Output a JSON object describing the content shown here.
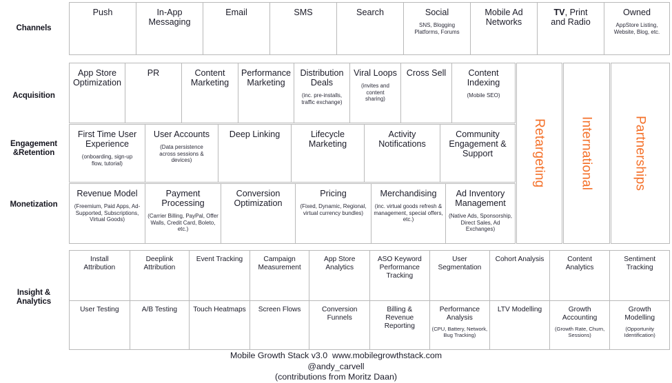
{
  "meta": {
    "accent_color": "#f4712a",
    "border_color": "#b9b9b9",
    "text_color": "#1b1b28"
  },
  "row_labels": {
    "channels": "Channels",
    "acquisition": "Acquisition",
    "engagement": "Engagement\n&Retention",
    "monetization": "Monetization",
    "insight": "Insight &\nAnalytics"
  },
  "channels": {
    "label": "Channels",
    "cells": [
      {
        "title": "Push",
        "sub": ""
      },
      {
        "title": "In-App\nMessaging",
        "sub": ""
      },
      {
        "title": "Email",
        "sub": ""
      },
      {
        "title": "SMS",
        "sub": ""
      },
      {
        "title": "Search",
        "sub": ""
      },
      {
        "title": "Social",
        "sub": "SNS, Blogging\nPlatforms, Forums"
      },
      {
        "title": "Mobile Ad\nNetworks",
        "sub": ""
      },
      {
        "title": "TV, Print\nand Radio",
        "sub": "",
        "bold_prefix": "TV"
      },
      {
        "title": "Owned",
        "sub": "AppStore Listing,\nWebsite, Blog, etc."
      }
    ]
  },
  "acquisition": {
    "label": "Acquisition",
    "cells": [
      {
        "title": "App Store\nOptimization",
        "sub": ""
      },
      {
        "title": "PR",
        "sub": ""
      },
      {
        "title": "Content\nMarketing",
        "sub": ""
      },
      {
        "title": "Performance\nMarketing",
        "sub": ""
      },
      {
        "title": "Distribution\nDeals",
        "sub": "(inc. pre-installs,\ntraffic exchange)"
      },
      {
        "title": "Viral Loops",
        "sub": "(invites and content\nsharing)"
      },
      {
        "title": "Cross Sell",
        "sub": ""
      },
      {
        "title": "Content\nIndexing",
        "sub": "(Mobile SEO)"
      }
    ]
  },
  "engagement": {
    "label": "Engagement\n&Retention",
    "cells": [
      {
        "title": "First Time User\nExperience",
        "sub": "(onboarding, sign-up\nflow, tutorial)"
      },
      {
        "title": "User Accounts",
        "sub": "(Data persistence\nacross sessions &\ndevices)"
      },
      {
        "title": "Deep Linking",
        "sub": ""
      },
      {
        "title": "Lifecycle\nMarketing",
        "sub": ""
      },
      {
        "title": "Activity\nNotifications",
        "sub": ""
      },
      {
        "title": "Community\nEngagement &\nSupport",
        "sub": ""
      }
    ]
  },
  "monetization": {
    "label": "Monetization",
    "cells": [
      {
        "title": "Revenue Model",
        "sub": "(Freemium, Paid Apps, Ad-\nSupported, Subscriptions,\nVirtual Goods)"
      },
      {
        "title": "Payment\nProcessing",
        "sub": "(Carrier Billing, PayPal, Offer\nWalls, Credit Card, Boleto,\netc.)"
      },
      {
        "title": "Conversion\nOptimization",
        "sub": ""
      },
      {
        "title": "Pricing",
        "sub": "(Fixed, Dynamic, Regional,\nvirtual currency bundles)"
      },
      {
        "title": "Merchandising",
        "sub": "(inc. virtual goods refresh &\nmanagement, special offers,\netc.)"
      },
      {
        "title": "Ad Inventory\nManagement",
        "sub": "(Native Ads, Sponsorship,\nDirect Sales, Ad Exchanges)"
      }
    ]
  },
  "vertical_columns": [
    {
      "label": "Retargeting"
    },
    {
      "label": "International"
    },
    {
      "label": "Partnerships"
    }
  ],
  "insight": {
    "label": "Insight &\nAnalytics",
    "row1": [
      {
        "title": "Install\nAttribution",
        "sub": ""
      },
      {
        "title": "Deeplink\nAttribution",
        "sub": ""
      },
      {
        "title": "Event Tracking",
        "sub": ""
      },
      {
        "title": "Campaign\nMeasurement",
        "sub": ""
      },
      {
        "title": "App Store\nAnalytics",
        "sub": ""
      },
      {
        "title": "ASO Keyword\nPerformance\nTracking",
        "sub": ""
      },
      {
        "title": "User\nSegmentation",
        "sub": ""
      },
      {
        "title": "Cohort Analysis",
        "sub": ""
      },
      {
        "title": "Content\nAnalytics",
        "sub": ""
      },
      {
        "title": "Sentiment\nTracking",
        "sub": ""
      }
    ],
    "row2": [
      {
        "title": "User Testing",
        "sub": ""
      },
      {
        "title": "A/B Testing",
        "sub": ""
      },
      {
        "title": "Touch Heatmaps",
        "sub": ""
      },
      {
        "title": "Screen Flows",
        "sub": ""
      },
      {
        "title": "Conversion\nFunnels",
        "sub": ""
      },
      {
        "title": "Billing &\nRevenue\nReporting",
        "sub": ""
      },
      {
        "title": "Performance\nAnalysis",
        "sub": "(CPU, Battery, Network,\nBug Tracking)"
      },
      {
        "title": "LTV Modelling",
        "sub": ""
      },
      {
        "title": "Growth\nAccounting",
        "sub": "(Growth Rate, Churn,\nSessions)"
      },
      {
        "title": "Growth\nModelling",
        "sub": "(Opportunity\nIdentification)"
      }
    ]
  },
  "footer": {
    "line1": "Mobile Growth Stack v3.0  www.mobilegrowthstack.com",
    "line2": "@andy_carvell",
    "line3": "(contributions from Moritz Daan)"
  }
}
